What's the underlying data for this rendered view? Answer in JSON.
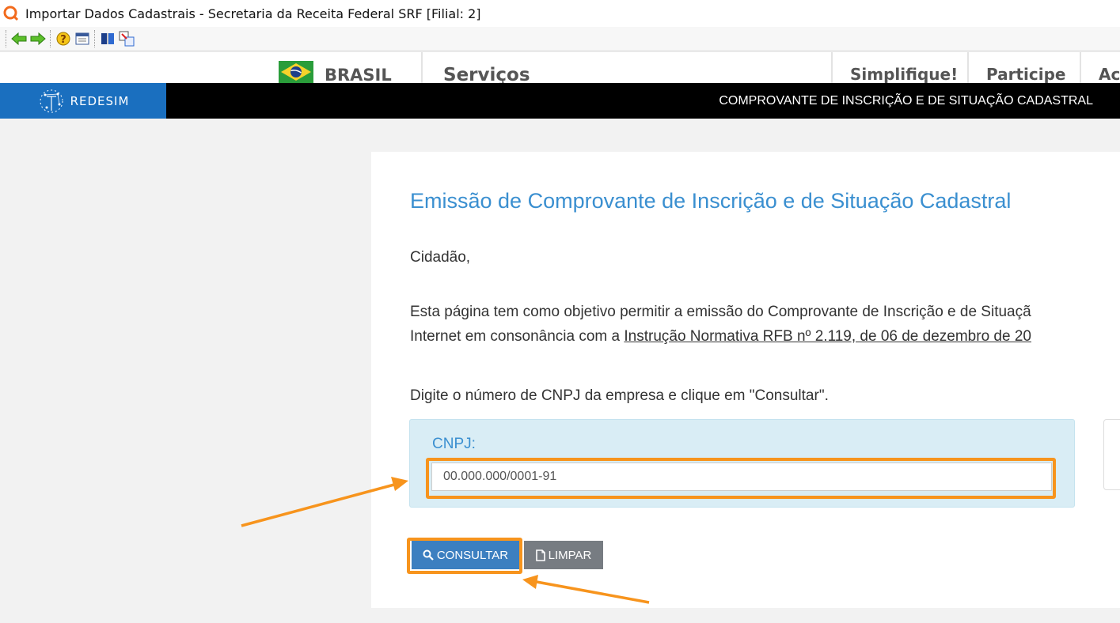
{
  "window": {
    "title": "Importar Dados Cadastrais - Secretaria da Receita Federal SRF [Filial: 2]"
  },
  "toolbar": {
    "icons": [
      "back-arrow-icon",
      "forward-arrow-icon",
      "help-icon",
      "calendar-icon",
      "book-icon",
      "import-icon"
    ]
  },
  "gov_header": {
    "brasil": "BRASIL",
    "servicos": "Serviços",
    "simplifique": "Simplifique!",
    "participe": "Participe",
    "acesso_partial": "Ac"
  },
  "redesim": {
    "logo_text": "REDESIM",
    "page_title": "COMPROVANTE DE INSCRIÇÃO E DE SITUAÇÃO CADASTRAL"
  },
  "content": {
    "heading": "Emissão de Comprovante de Inscrição e de Situação Cadastral",
    "greeting": "Cidadão,",
    "paragraph_line1": "Esta página tem como objetivo permitir a emissão do Comprovante de Inscrição e de Situaçã",
    "paragraph_line2_prefix": "Internet em consonância com a ",
    "paragraph_line2_link": "Instrução Normativa RFB nº 2.119, de 06 de dezembro de 20",
    "instruction": "Digite o número de CNPJ da empresa e clique em \"Consultar\".",
    "cnpj_label": "CNPJ:",
    "cnpj_value": "00.000.000/0001-91",
    "btn_consultar": "CONSULTAR",
    "btn_limpar": "LIMPAR"
  },
  "colors": {
    "highlight": "#f7941d",
    "heading_blue": "#3a8fd0",
    "redesim_blue": "#1a6fbf",
    "consultar_btn": "#3c7fc0",
    "limpar_btn": "#777c82",
    "cnpj_box_bg": "#d9edf5"
  }
}
